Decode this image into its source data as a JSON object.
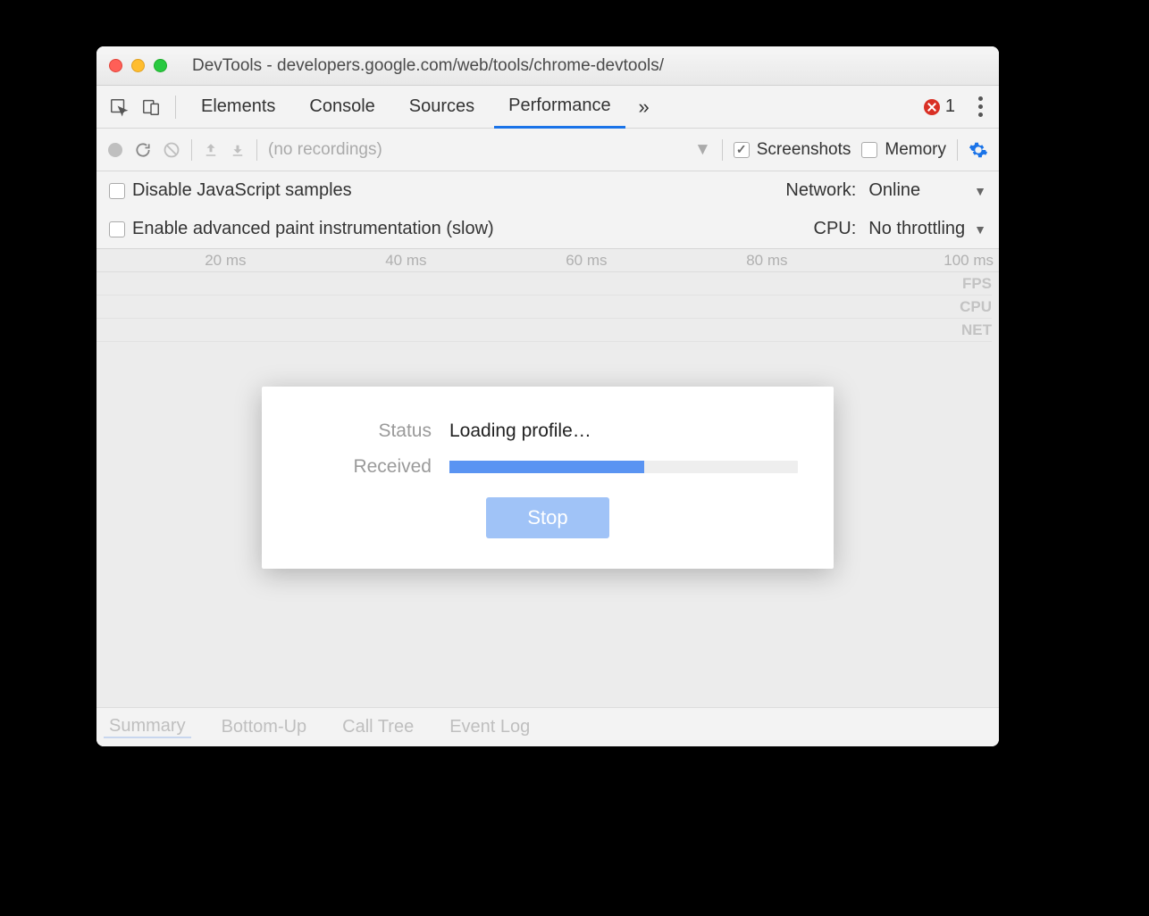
{
  "window_title": "DevTools - developers.google.com/web/tools/chrome-devtools/",
  "tabs": {
    "elements": "Elements",
    "console": "Console",
    "sources": "Sources",
    "performance": "Performance"
  },
  "error_count": "1",
  "toolbar": {
    "recordings_placeholder": "(no recordings)",
    "screenshots_label": "Screenshots",
    "memory_label": "Memory"
  },
  "settings": {
    "disable_js": "Disable JavaScript samples",
    "enable_paint": "Enable advanced paint instrumentation (slow)",
    "network_label": "Network:",
    "network_value": "Online",
    "cpu_label": "CPU:",
    "cpu_value": "No throttling"
  },
  "ruler": {
    "t20": "20 ms",
    "t40": "40 ms",
    "t60": "60 ms",
    "t80": "80 ms",
    "t100": "100 ms"
  },
  "lanes": {
    "fps": "FPS",
    "cpu": "CPU",
    "net": "NET"
  },
  "dialog": {
    "status_label": "Status",
    "status_value": "Loading profile…",
    "received_label": "Received",
    "stop": "Stop"
  },
  "bottom_tabs": {
    "summary": "Summary",
    "bottomup": "Bottom-Up",
    "calltree": "Call Tree",
    "eventlog": "Event Log"
  }
}
